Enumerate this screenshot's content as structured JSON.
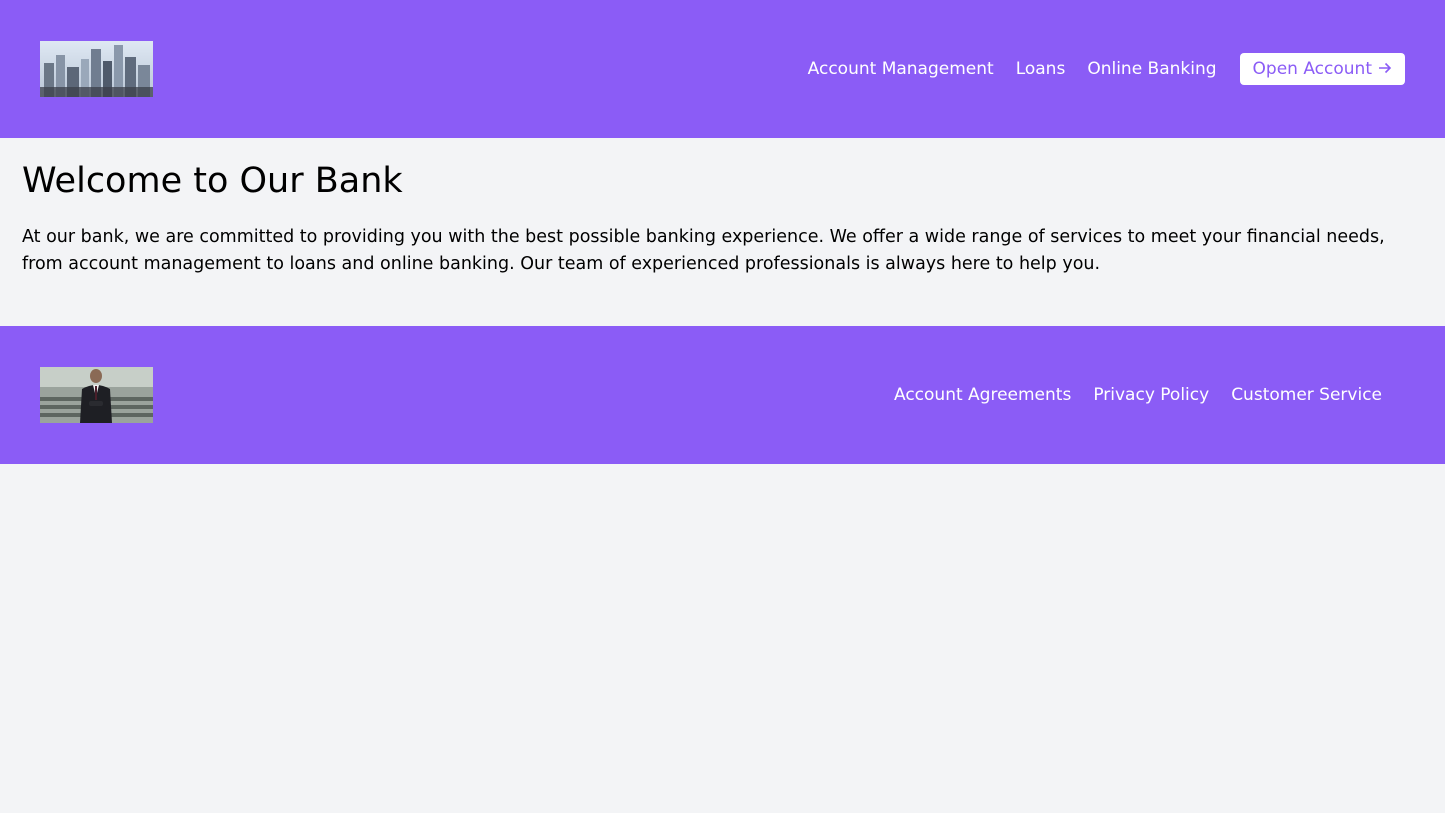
{
  "header": {
    "logo_alt": "Bank logo",
    "nav": [
      "Account Management",
      "Loans",
      "Online Banking"
    ],
    "cta_label": "Open Account",
    "cta_icon": "arrow-right-icon"
  },
  "main": {
    "title": "Welcome to Our Bank",
    "intro": "At our bank, we are committed to providing you with the best possible banking experience. We offer a wide range of services to meet your financial needs, from account management to loans and online banking. Our team of experienced professionals is always here to help you."
  },
  "footer": {
    "logo_alt": "Bank footer logo",
    "links": [
      "Account Agreements",
      "Privacy Policy",
      "Customer Service"
    ]
  },
  "colors": {
    "brand": "#8b5cf6",
    "background": "#f3f4f6",
    "text": "#000000"
  }
}
